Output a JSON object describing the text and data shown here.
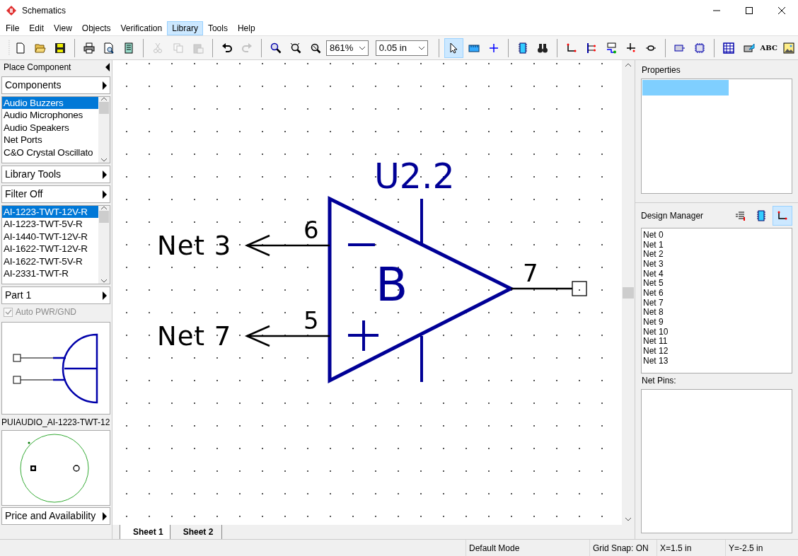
{
  "window": {
    "title": "Schematics"
  },
  "menu": [
    {
      "label": "File",
      "selected": false
    },
    {
      "label": "Edit",
      "selected": false
    },
    {
      "label": "View",
      "selected": false
    },
    {
      "label": "Objects",
      "selected": false
    },
    {
      "label": "Verification",
      "selected": false
    },
    {
      "label": "Library",
      "selected": true
    },
    {
      "label": "Tools",
      "selected": false
    },
    {
      "label": "Help",
      "selected": false
    }
  ],
  "toolbar": [
    {
      "kind": "button",
      "disabled": false,
      "selected": false
    },
    {
      "kind": "button",
      "disabled": false,
      "selected": false
    },
    {
      "kind": "button",
      "disabled": false,
      "selected": false
    },
    {
      "kind": "separator"
    },
    {
      "kind": "button",
      "disabled": false,
      "selected": false
    },
    {
      "kind": "button",
      "disabled": false,
      "selected": false
    },
    {
      "kind": "button",
      "disabled": false,
      "selected": false
    },
    {
      "kind": "separator"
    },
    {
      "kind": "button",
      "disabled": true,
      "selected": false
    },
    {
      "kind": "button",
      "disabled": true,
      "selected": false
    },
    {
      "kind": "button",
      "disabled": true,
      "selected": false
    },
    {
      "kind": "separator"
    },
    {
      "kind": "button",
      "disabled": false,
      "selected": false
    },
    {
      "kind": "button",
      "disabled": true,
      "selected": false
    },
    {
      "kind": "separator"
    },
    {
      "kind": "button",
      "disabled": false,
      "selected": false
    },
    {
      "kind": "button",
      "disabled": false,
      "selected": false
    },
    {
      "kind": "button",
      "disabled": false,
      "selected": false
    },
    {
      "kind": "combo",
      "value": "861%"
    },
    {
      "kind": "combo",
      "value": "0.05 in"
    },
    {
      "kind": "separator"
    },
    {
      "kind": "button",
      "disabled": false,
      "selected": true
    },
    {
      "kind": "button",
      "disabled": false,
      "selected": false
    },
    {
      "kind": "button",
      "disabled": false,
      "selected": false
    },
    {
      "kind": "separator"
    },
    {
      "kind": "button",
      "disabled": false,
      "selected": false
    },
    {
      "kind": "button",
      "disabled": false,
      "selected": false
    },
    {
      "kind": "separator"
    },
    {
      "kind": "button",
      "disabled": false,
      "selected": false
    },
    {
      "kind": "button",
      "disabled": false,
      "selected": false
    },
    {
      "kind": "button",
      "disabled": false,
      "selected": false
    },
    {
      "kind": "button",
      "disabled": false,
      "selected": false
    },
    {
      "kind": "button",
      "disabled": false,
      "selected": false
    },
    {
      "kind": "separator"
    },
    {
      "kind": "button",
      "disabled": false,
      "selected": false
    },
    {
      "kind": "button",
      "disabled": false,
      "selected": false
    },
    {
      "kind": "separator"
    },
    {
      "kind": "button",
      "disabled": false,
      "selected": false
    },
    {
      "kind": "button",
      "disabled": false,
      "selected": false
    },
    {
      "kind": "text_button",
      "label": "ABC",
      "disabled": false,
      "selected": false
    },
    {
      "kind": "button",
      "disabled": false,
      "selected": false
    }
  ],
  "left_panel": {
    "title": "Place Component",
    "components_header": "Components",
    "categories": [
      {
        "label": "Audio Buzzers",
        "selected": true
      },
      {
        "label": "Audio Microphones",
        "selected": false
      },
      {
        "label": "Audio Speakers",
        "selected": false
      },
      {
        "label": "Net Ports",
        "selected": false
      },
      {
        "label": "C&O Crystal Oscillato",
        "selected": false
      }
    ],
    "library_tools_header": "Library Tools",
    "filter_header": "Filter Off",
    "parts": [
      {
        "label": "AI-1223-TWT-12V-R",
        "selected": true
      },
      {
        "label": "AI-1223-TWT-5V-R",
        "selected": false
      },
      {
        "label": "AI-1440-TWT-12V-R",
        "selected": false
      },
      {
        "label": "AI-1622-TWT-12V-R",
        "selected": false
      },
      {
        "label": "AI-1622-TWT-5V-R",
        "selected": false
      },
      {
        "label": "AI-2331-TWT-R",
        "selected": false
      }
    ],
    "part_header": "Part 1",
    "auto_pwr_gnd": {
      "label": "Auto PWR/GND",
      "checked": true,
      "disabled": true
    },
    "footprint_name": "PUIAUDIO_AI-1223-TWT-12",
    "price_header": "Price and Availability"
  },
  "schematic": {
    "designator": "U2.2",
    "unit_letter": "B",
    "pins": [
      {
        "number": "6",
        "net": "Net 3",
        "kind": "input",
        "inverting": true
      },
      {
        "number": "5",
        "net": "Net 7",
        "kind": "input",
        "inverting": false
      },
      {
        "number": "7",
        "kind": "output"
      }
    ]
  },
  "sheet_tabs": [
    {
      "label": "Sheet 1",
      "selected": true
    },
    {
      "label": "Sheet 2",
      "selected": false
    }
  ],
  "properties": {
    "title": "Properties",
    "rows": [
      {
        "selected": true
      }
    ]
  },
  "design_manager": {
    "title": "Design Manager",
    "views": [
      {
        "selected": false
      },
      {
        "selected": false
      },
      {
        "selected": true
      }
    ],
    "nets": [
      "Net 0",
      "Net 1",
      "Net 2",
      "Net 3",
      "Net 4",
      "Net 5",
      "Net 6",
      "Net 7",
      "Net 8",
      "Net 9",
      "Net 10",
      "Net 11",
      "Net 12",
      "Net 13"
    ],
    "net_pins_title": "Net Pins:"
  },
  "status_bar": [
    "Default Mode",
    "Grid Snap: ON",
    "X=1.5 in",
    "Y=-2.5 in"
  ]
}
